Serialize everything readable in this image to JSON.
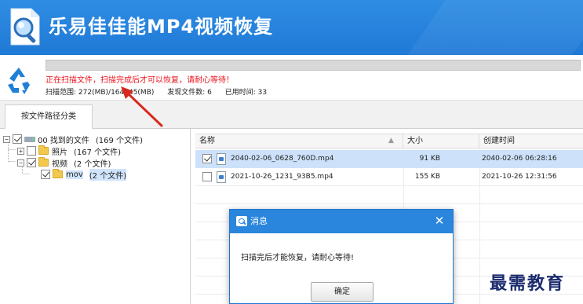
{
  "app": {
    "title": "乐易佳佳能MP4视频恢复"
  },
  "scan": {
    "progress_fraction": 0.0,
    "status_text": "正在扫描文件，扫描完成后才可以恢复，请耐心等待！",
    "range": "扫描范围: 272(MB)/164845(MB)",
    "found": "发现文件数: 6",
    "elapsed": "已用时间: 33"
  },
  "tabs": [
    {
      "label": "按文件路径分类"
    }
  ],
  "tree": {
    "root": {
      "label": "00 找到的文件",
      "count": "(169 个文件)"
    },
    "photos": {
      "label": "照片",
      "count": "(167 个文件)"
    },
    "videos": {
      "label": "视频",
      "count": "(2 个文件)"
    },
    "mov": {
      "label": "mov",
      "count": "(2 个文件)"
    }
  },
  "list": {
    "columns": {
      "name": "名称",
      "size": "大小",
      "created": "创建时间"
    },
    "rows": [
      {
        "name": "2040-02-06_0628_760D.mp4",
        "size": "91 KB",
        "created": "2040-02-06  06:28:16"
      },
      {
        "name": "2021-10-26_1231_93B5.mp4",
        "size": "155 KB",
        "created": "2021-10-26  12:31:56"
      }
    ]
  },
  "dialog": {
    "title": "消息",
    "close_glyph": "✕",
    "message": "扫描完后才能恢复，请耐心等待!",
    "ok_label": "确定"
  },
  "watermark": "最需教育",
  "colors": {
    "title_bar": "#2a86dd",
    "status_text": "#e8141e",
    "selection": "#cde2fa",
    "annotation_arrow": "#d9281e"
  }
}
